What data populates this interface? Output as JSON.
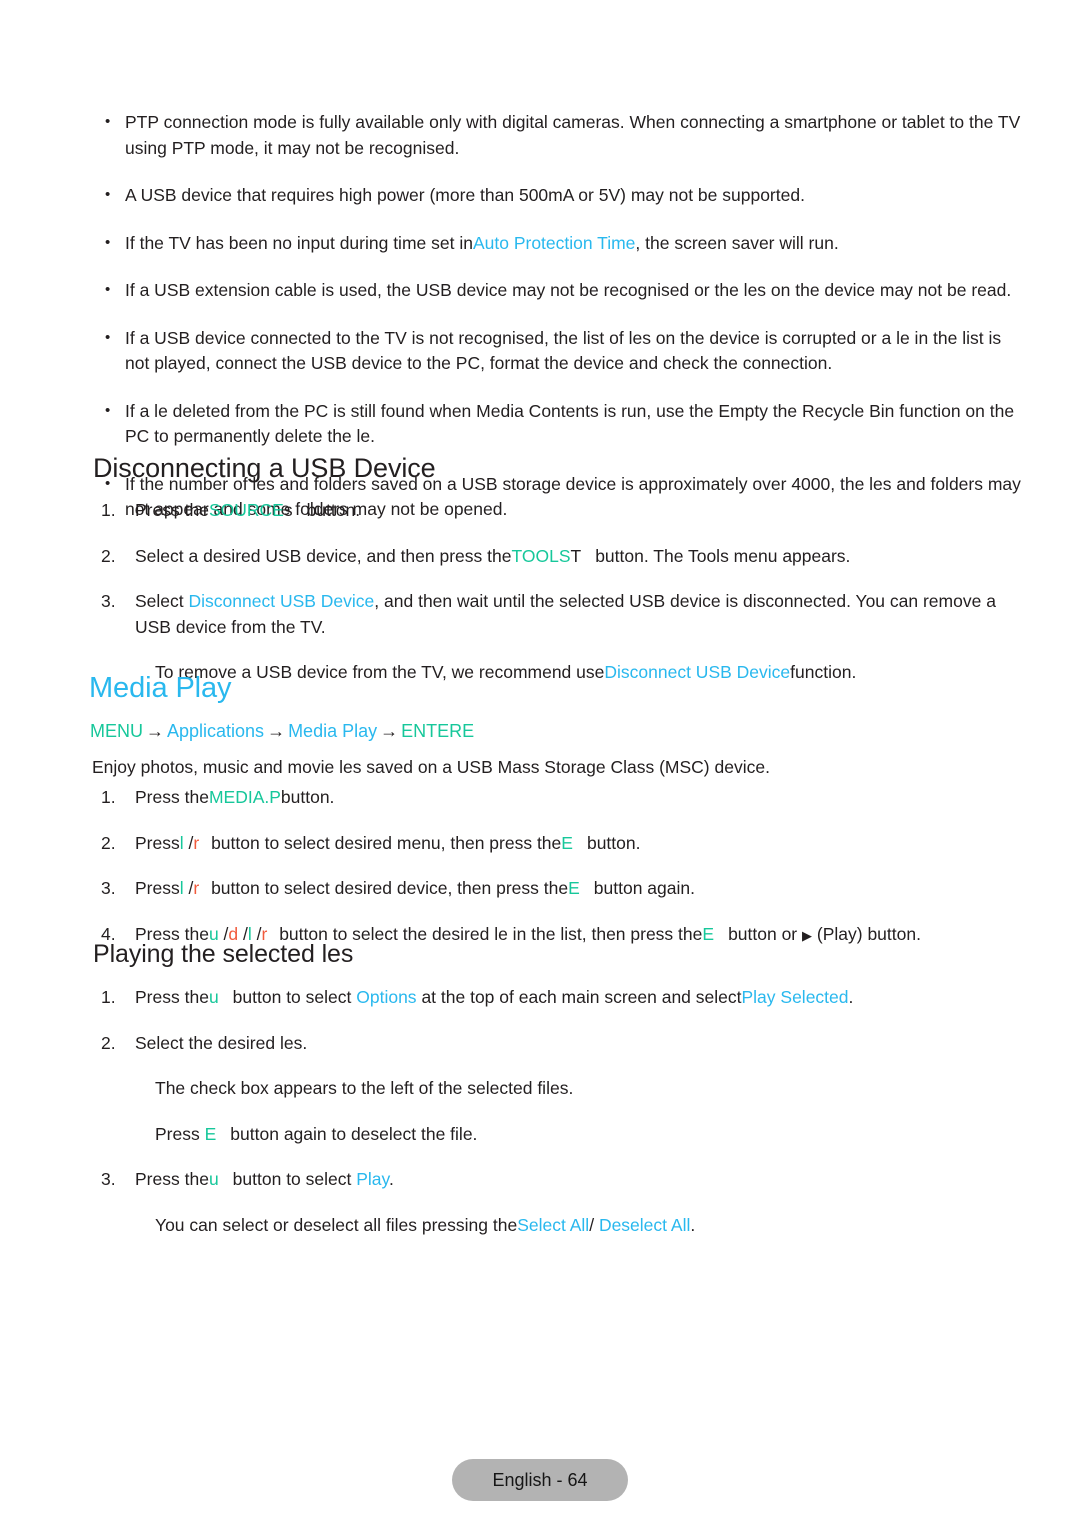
{
  "page": {
    "language_footer": "English - 64"
  },
  "notes": {
    "bullets": [
      "PTP connection mode is fully available only with digital cameras. When connecting a smartphone or tablet to the TV using PTP mode, it may not be recognised.",
      "A USB device that requires high power (more than 500mA or 5V) may not be supported.",
      "If a USB extension cable is used, the USB device may not be recognised or the  les on the device may not be read.",
      "If a USB device connected to the TV is not recognised, the list of  les on the device is corrupted or a  le in the list is not played, connect the USB device to the PC, format the device and check the connection.",
      "If a  le deleted from the PC is still found when Media Contents is run, use the  Empty the Recycle Bin  function on the PC to permanently delete the  le.",
      "If the number of  les and folders saved on a USB storage device is approximately over 4000, the  les and folders may not appear and some folders may not be opened."
    ],
    "auto_protection_bullet": {
      "before": "If the TV has been no input during time set in",
      "link": "Auto Protection Time",
      "after": ", the screen saver will run."
    }
  },
  "disconnect_section": {
    "heading": "Disconnecting a USB Device",
    "steps": [
      {
        "num": "1.",
        "before": "Press the",
        "key_label": "SOURCE",
        "key_glyph": "s",
        "after": "button."
      },
      {
        "num": "2.",
        "before": "Select a desired USB device, and then press the",
        "key_label": "TOOLS",
        "key_glyph": "T",
        "after": "button. The Tools menu appears."
      },
      {
        "num": "3.",
        "before": "Select",
        "menu_item": "Disconnect USB Device",
        "after": ", and then wait until the selected USB device is disconnected. You can remove a USB device from the TV."
      }
    ],
    "note": {
      "before": "To remove a USB device from the TV, we recommend use",
      "menu_item": "Disconnect USB Device",
      "after": "function."
    }
  },
  "media_play_section": {
    "heading": "Media Play",
    "breadcrumb": {
      "menu": "MENU",
      "arrow": "→",
      "applications": "Applications",
      "media_play": "Media Play",
      "enter": "ENTER",
      "enter_glyph": "E"
    },
    "intro": "Enjoy photos, music and movie  les saved on a USB Mass Storage Class (MSC) device.",
    "steps": [
      {
        "num": "1.",
        "before": "Press the",
        "key_label": "MEDIA.P",
        "after": "button."
      },
      {
        "num": "2.",
        "before": "Press",
        "keys": [
          "l",
          "r"
        ],
        "mid": "button to select desired menu, then press the",
        "enter_glyph": "E",
        "after": "button."
      },
      {
        "num": "3.",
        "before": "Press",
        "keys": [
          "l",
          "r"
        ],
        "mid": "button to select desired device, then press the",
        "enter_glyph": "E",
        "after": "button again."
      },
      {
        "num": "4.",
        "before": "Press the",
        "keys": [
          "u",
          "d",
          "l",
          "r"
        ],
        "mid": "button to select the desired  le in the list, then press the",
        "enter_glyph": "E",
        "mid2": "button or",
        "play_glyph": "▶",
        "after": "(Play) button."
      }
    ]
  },
  "playing_section": {
    "heading": "Playing the selected  les",
    "steps": [
      {
        "num": "1.",
        "before": "Press the",
        "key_glyph": "u",
        "mid": "button to select",
        "menu_item": "Options",
        "mid2": "at the top of each main screen and select",
        "menu_item2": "Play Selected",
        "after": "."
      },
      {
        "num": "2.",
        "text": "Select the desired  les."
      },
      {
        "num": "3.",
        "before": "Press the",
        "key_glyph": "u",
        "mid": "button to select",
        "menu_item": "Play",
        "after": "."
      }
    ],
    "note_checkbox": "The check box appears to the left of the selected files.",
    "note_deselect": {
      "before": "Press",
      "enter_glyph": "E",
      "after": "button again to deselect the file."
    },
    "note_selectall": {
      "before": "You can select or deselect all files pressing the",
      "select_all": "Select All",
      "separator": "/",
      "deselect_all": "Deselect All",
      "after": "."
    }
  },
  "colors": {
    "teal": "#16c79a",
    "sky": "#29b8ee",
    "orange": "#f15a3c",
    "text": "#231f20",
    "footer_bg": "#b3b3b3"
  }
}
